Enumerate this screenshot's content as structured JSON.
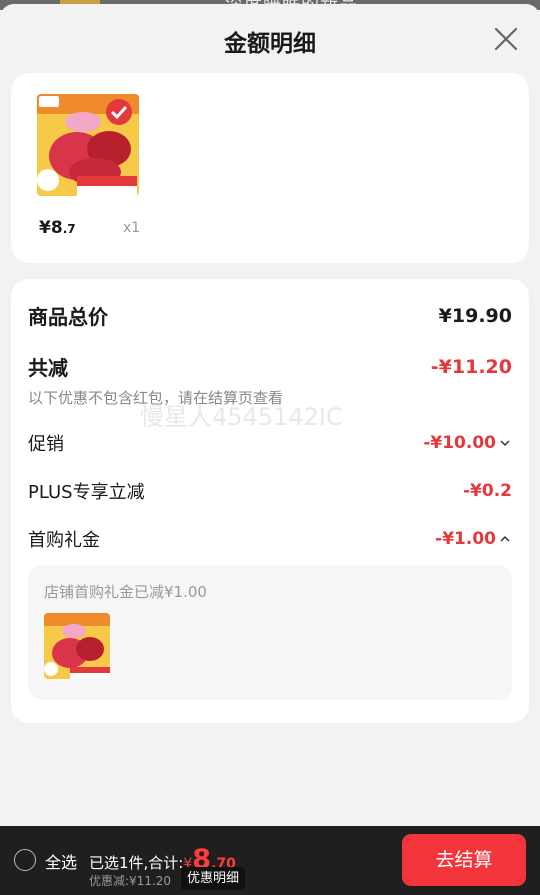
{
  "background_peek": {
    "text": "深度睡眠的新品"
  },
  "sheet": {
    "title": "金额明细",
    "product": {
      "price_symbol": "¥",
      "price_int": "8",
      "price_dec": ".7",
      "quantity": "x1",
      "thumb_badge_left": "9.",
      "thumb_banner": "下单立减10元"
    },
    "breakdown": {
      "total_label": "商品总价",
      "total_value": "¥19.90",
      "reduce_label": "共减",
      "reduce_value": "-¥11.20",
      "note": "以下优惠不包含红包，请在结算页查看",
      "watermark": "慢星人4545142IC",
      "items": [
        {
          "label": "促销",
          "value": "-¥10.00",
          "chevron": "down"
        },
        {
          "label": "PLUS专享立减",
          "value": "-¥0.2",
          "chevron": "none"
        },
        {
          "label": "首购礼金",
          "value": "-¥1.00",
          "chevron": "up"
        }
      ],
      "sub_box": {
        "title": "店铺首购礼金已减¥1.00"
      }
    }
  },
  "bottom_bar": {
    "select_all": "全选",
    "selected_text": "已选1件,合计:",
    "total_symbol": "¥",
    "total_int": "8",
    "total_dec": ".70",
    "discount_text": "优惠减:¥11.20",
    "detail_button": "优惠明细",
    "checkout_button": "去结算"
  },
  "colors": {
    "accent_red": "#e4393c",
    "checkout_red": "#f2353b",
    "bar_dark": "#1f1f1f"
  }
}
